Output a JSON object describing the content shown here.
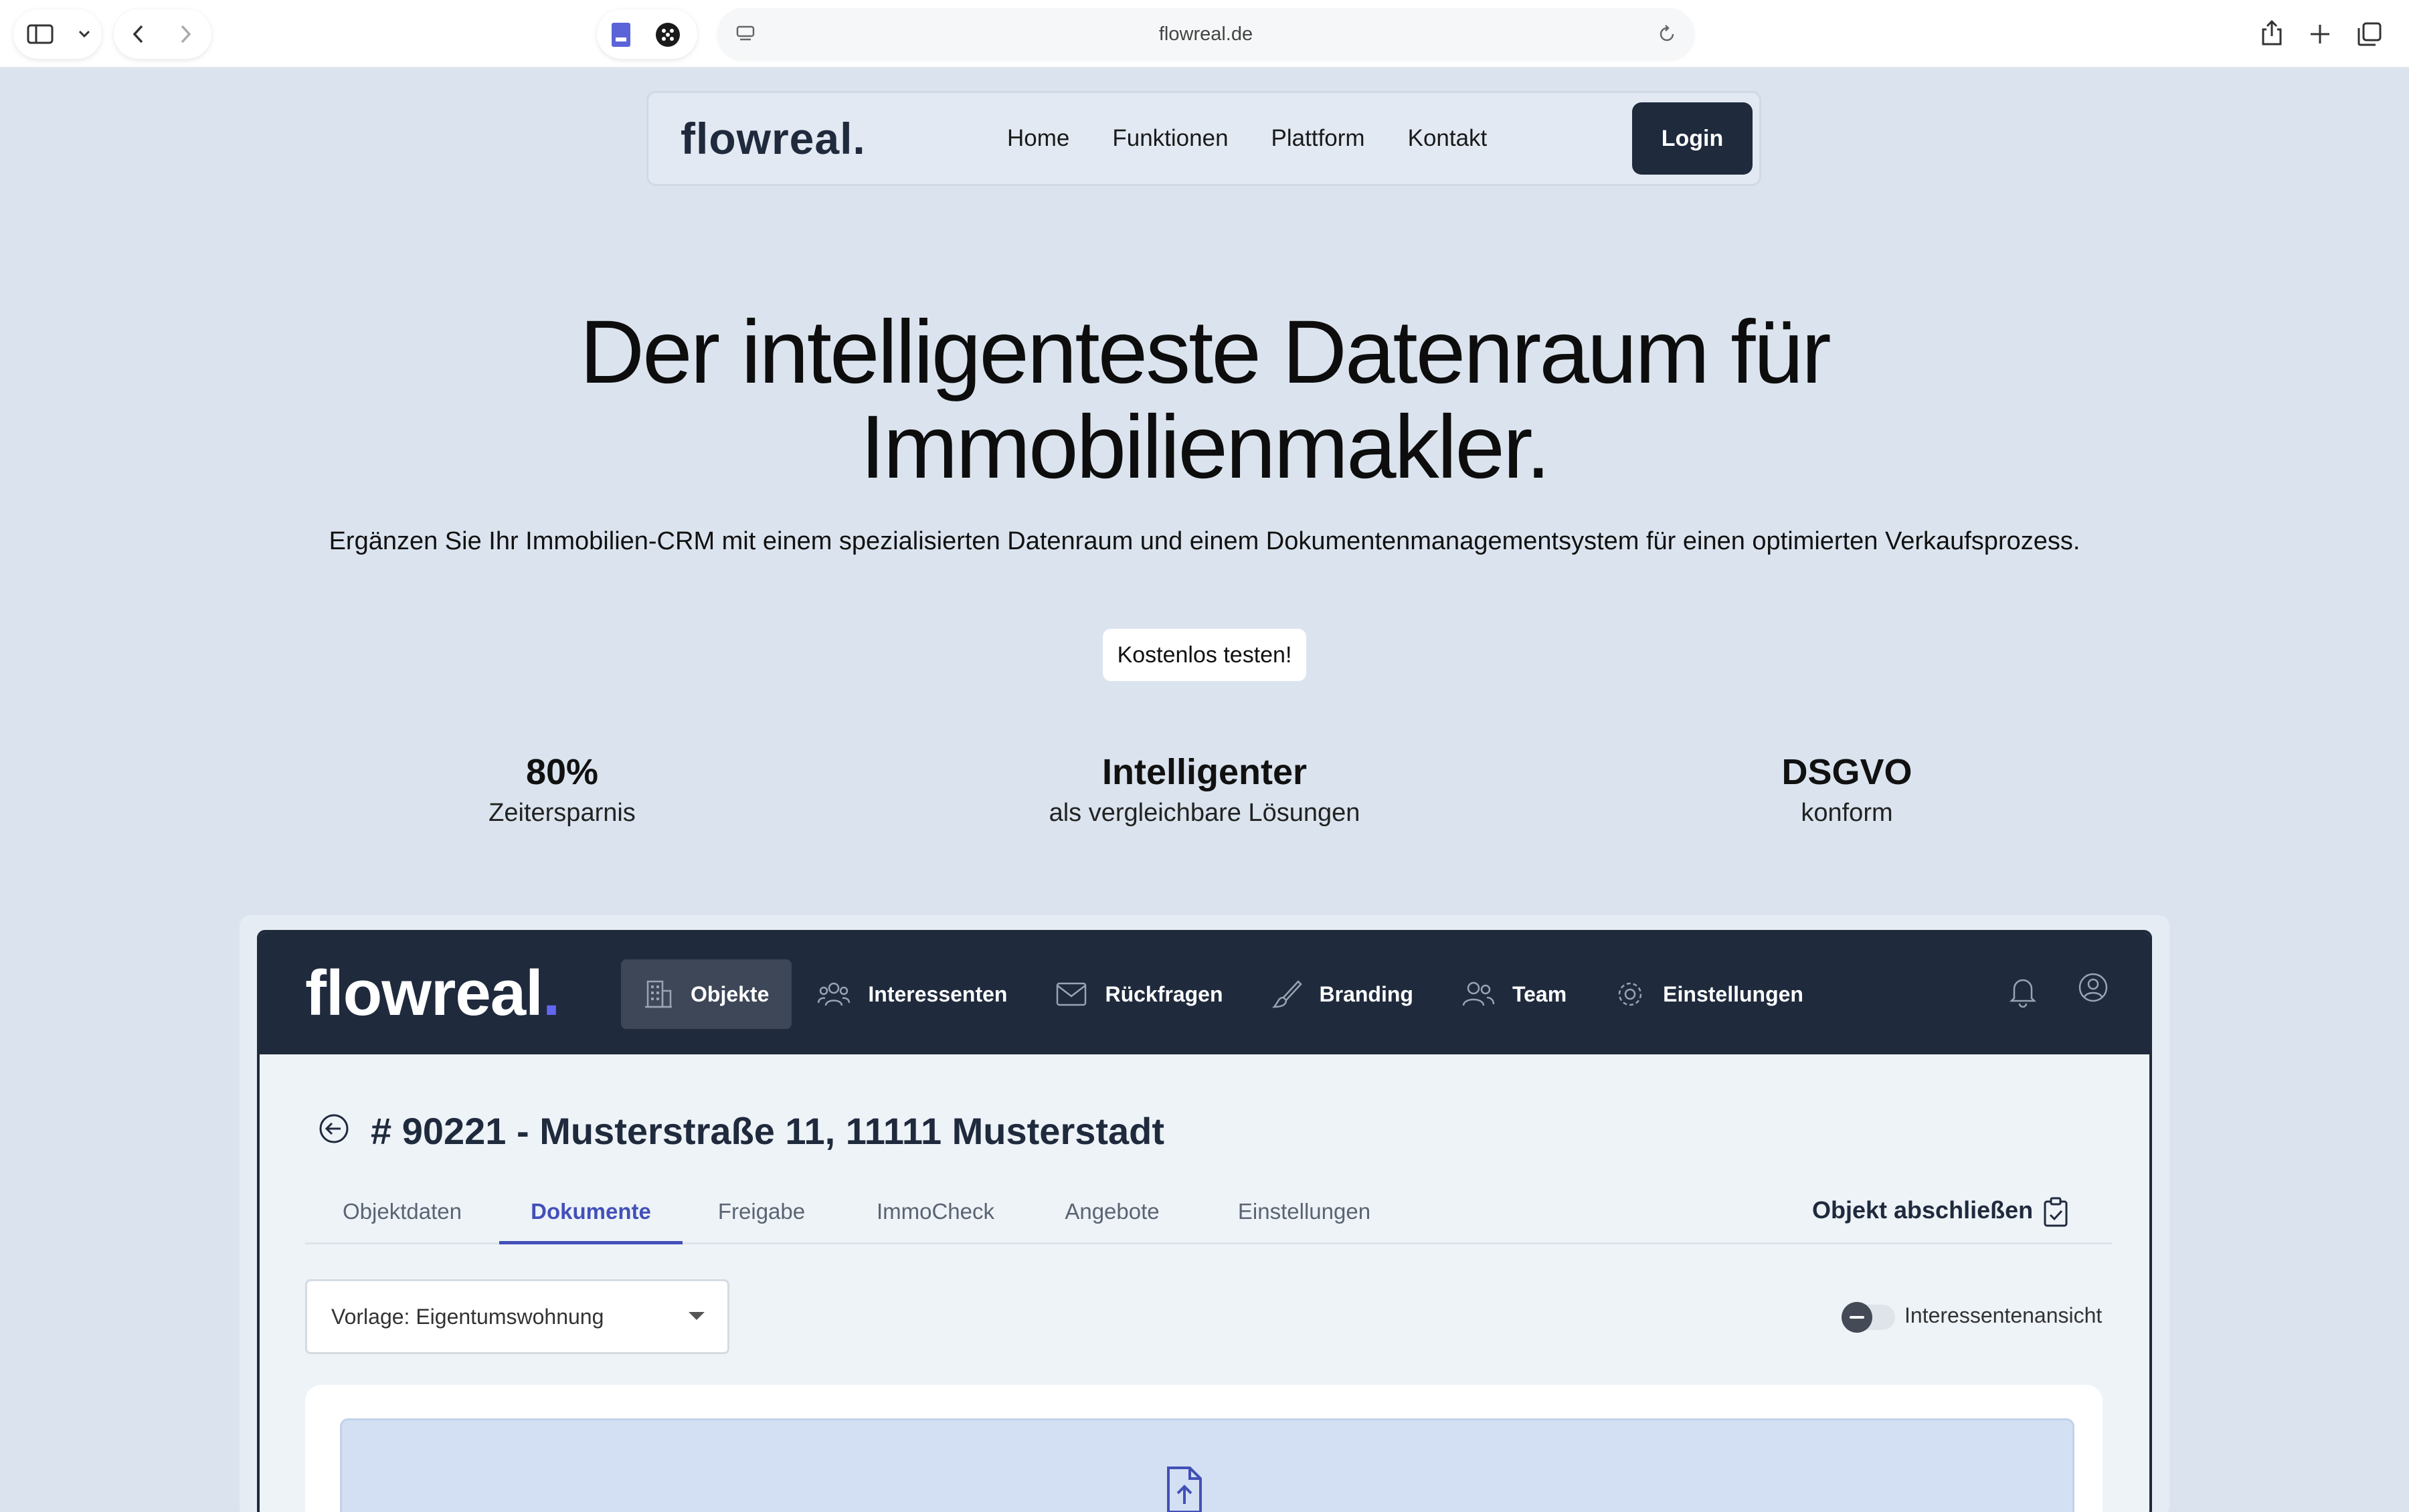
{
  "browser": {
    "url": "flowreal.de"
  },
  "site": {
    "logo": "flowreal.",
    "nav": [
      "Home",
      "Funktionen",
      "Plattform",
      "Kontakt"
    ],
    "login": "Login"
  },
  "hero": {
    "title_line1": "Der intelligenteste Datenraum für",
    "title_line2": "Immobilienmakler.",
    "subtitle": "Ergänzen Sie Ihr Immobilien-CRM mit einem spezialisierten Datenraum und einem Dokumentenmanagementsystem für einen optimierten Verkaufsprozess.",
    "cta": "Kostenlos testen!"
  },
  "stats": [
    {
      "value": "80%",
      "label": "Zeitersparnis"
    },
    {
      "value": "Intelligenter",
      "label": "als vergleichbare Lösungen"
    },
    {
      "value": "DSGVO",
      "label": "konform"
    }
  ],
  "app": {
    "logo": "flowreal",
    "logo_dot": ".",
    "menu": [
      {
        "label": "Objekte",
        "icon": "building-icon",
        "active": true
      },
      {
        "label": "Interessenten",
        "icon": "users-icon"
      },
      {
        "label": "Rückfragen",
        "icon": "envelope-icon"
      },
      {
        "label": "Branding",
        "icon": "brush-icon"
      },
      {
        "label": "Team",
        "icon": "team-icon"
      },
      {
        "label": "Einstellungen",
        "icon": "gear-icon"
      }
    ],
    "object_title": "# 90221 - Musterstraße 11, 11111 Musterstadt",
    "tabs": [
      "Objektdaten",
      "Dokumente",
      "Freigabe",
      "ImmoCheck",
      "Angebote",
      "Einstellungen"
    ],
    "active_tab": "Dokumente",
    "close_object": "Objekt abschließen",
    "template_select": "Vorlage: Eigentumswohnung",
    "toggle_label": "Interessentenansicht",
    "accent_color": "#4350b8",
    "nav_color": "#1f2a3d"
  }
}
